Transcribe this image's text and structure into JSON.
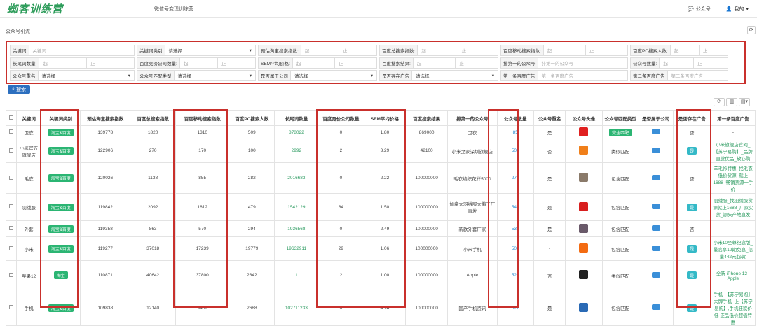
{
  "topbar": {
    "logo": "蜘客训练营",
    "system_title": "微信号变现训练营",
    "nav_item": "公众号",
    "user": "我的"
  },
  "breadcrumb": "公众号引流",
  "filters": {
    "row1": [
      {
        "label": "关键词",
        "placeholder": "关键词"
      },
      {
        "label": "关键词类别",
        "select": "请选择"
      },
      {
        "label": "预估淘宝搜索指数:",
        "from": "起",
        "to": "止"
      },
      {
        "label": "百度总搜索指数:",
        "from": "起",
        "to": "止"
      },
      {
        "label": "百度移动搜索指数:",
        "from": "起",
        "to": "止"
      },
      {
        "label": "百度PC搜索人数:",
        "from": "起",
        "to": "止"
      }
    ],
    "row2": [
      {
        "label": "长尾词数量:",
        "from": "起",
        "to": "止"
      },
      {
        "label": "百度竞价公司数量:",
        "from": "起",
        "to": "止"
      },
      {
        "label": "SEM平均价格:",
        "from": "起",
        "to": "止"
      },
      {
        "label": "百度搜索结果:",
        "from": "起",
        "to": "止"
      },
      {
        "label": "排第一的公众号",
        "placeholder": "排第一的公众号"
      },
      {
        "label": "公众号数量:",
        "from": "起",
        "to": "止"
      }
    ],
    "row3": [
      {
        "label": "公众号重名",
        "select": "请选择"
      },
      {
        "label": "公众号匹配类型",
        "select": "请选择"
      },
      {
        "label": "是否属于公司",
        "select": "请选择"
      },
      {
        "label": "是否存在广告",
        "select": "请选择"
      },
      {
        "label": "第一条百度广告",
        "placeholder": "第一条百度广告"
      },
      {
        "label": "第二条百度广告",
        "placeholder": "第二条百度广告"
      }
    ]
  },
  "search_button": "搜索",
  "table": {
    "headers": [
      "关键词",
      "关键词类别",
      "预估淘宝搜索指数",
      "百度总搜索指数",
      "百度移动搜索指数",
      "百度PC搜索人数",
      "长尾词数量",
      "百度竞价公司数量",
      "SEM平均价格",
      "百度搜索结果",
      "排第一的公众号",
      "公众号数量",
      "公众号重名",
      "公众号头像",
      "公众号匹配类型",
      "是否属于公司",
      "是否存在广告",
      "第一条百度广告"
    ],
    "rows": [
      {
        "kw": "卫衣",
        "cat": "淘宝&百度",
        "tb": "139778",
        "bd": "1820",
        "mob": "1310",
        "pc": "509",
        "lt": "878022",
        "comp": "0",
        "sem": "1.80",
        "res": "869000",
        "first": "卫衣",
        "count": "85",
        "dup": "是",
        "avatar": "#e02020",
        "match": "完全匹配",
        "company": "",
        "ad": "否",
        "ad1": "-"
      },
      {
        "kw": "小米官方旗舰店",
        "cat": "淘宝&百度",
        "tb": "122906",
        "bd": "270",
        "mob": "170",
        "pc": "100",
        "lt": "2992",
        "comp": "2",
        "sem": "3.29",
        "res": "42100",
        "first": "小米之家深圳旗舰店",
        "count": "509",
        "dup": "否",
        "avatar": "#f07f1a",
        "match": "类似匹配",
        "company": "",
        "ad": "是",
        "ad1": "小米旗舰店官网_【苏宁易购】_品牌直营优品_放心购"
      },
      {
        "kw": "毛衣",
        "cat": "淘宝&百度",
        "tb": "120026",
        "bd": "1138",
        "mob": "855",
        "pc": "282",
        "lt": "2016683",
        "comp": "0",
        "sem": "2.22",
        "res": "100000000",
        "first": "毛衣编织花样5000",
        "count": "272",
        "dup": "是",
        "avatar": "#8a7a6a",
        "match": "包含匹配",
        "company": "",
        "ad": "否",
        "ad1": "羊毛衫特惠_找毛衣低价货源_就上1688_畅销货源一手价"
      },
      {
        "kw": "羽绒服",
        "cat": "淘宝&百度",
        "tb": "119842",
        "bd": "2092",
        "mob": "1612",
        "pc": "479",
        "lt": "1542129",
        "comp": "84",
        "sem": "1.50",
        "res": "100000000",
        "first": "加拿大羽绒服大鹅工厂直发",
        "count": "542",
        "dup": "是",
        "avatar": "#d81e1e",
        "match": "包含匹配",
        "company": "",
        "ad": "是",
        "ad1": "羽绒服_找羽绒服货源就上1688_厂家实货_源头产地直发"
      },
      {
        "kw": "外套",
        "cat": "淘宝&百度",
        "tb": "119358",
        "bd": "863",
        "mob": "570",
        "pc": "294",
        "lt": "1936568",
        "comp": "0",
        "sem": "2.49",
        "res": "100000000",
        "first": "新款外套厂家",
        "count": "533",
        "dup": "是",
        "avatar": "#6a5a6a",
        "match": "包含匹配",
        "company": "",
        "ad": "否",
        "ad1": "-"
      },
      {
        "kw": "小米",
        "cat": "淘宝&百度",
        "tb": "119277",
        "bd": "37018",
        "mob": "17239",
        "pc": "19779",
        "lt": "19632911",
        "comp": "29",
        "sem": "1.06",
        "res": "100000000",
        "first": "小米手机",
        "count": "509",
        "dup": "-",
        "avatar": "#f36b12",
        "match": "包含匹配",
        "company": "",
        "ad": "是",
        "ad1": "小米10至尊纪念版_最高享12期免息_信量442元起/期"
      },
      {
        "kw": "苹果12",
        "cat": "淘宝",
        "tb": "110871",
        "bd": "40642",
        "mob": "37800",
        "pc": "2842",
        "lt": "1",
        "comp": "2",
        "sem": "1.00",
        "res": "100000000",
        "first": "Apple",
        "count": "521",
        "dup": "否",
        "avatar": "#222222",
        "match": "类似匹配",
        "company": "",
        "ad": "是",
        "ad1": "全新 iPhone 12 - Apple"
      },
      {
        "kw": "手机",
        "cat": "淘宝&百度",
        "tb": "109838",
        "bd": "12140",
        "mob": "9452",
        "pc": "2688",
        "lt": "102711233",
        "comp": "0",
        "sem": "4.24",
        "res": "100000000",
        "first": "国产手机资讯",
        "count": "527",
        "dup": "是",
        "avatar": "#2a6ab5",
        "match": "包含匹配",
        "company": "",
        "ad": "是",
        "ad1": "手机_【苏宁易购】大牌手机_上【苏宁易购】,手机狂欢价低-正品低价超值特惠"
      }
    ]
  }
}
